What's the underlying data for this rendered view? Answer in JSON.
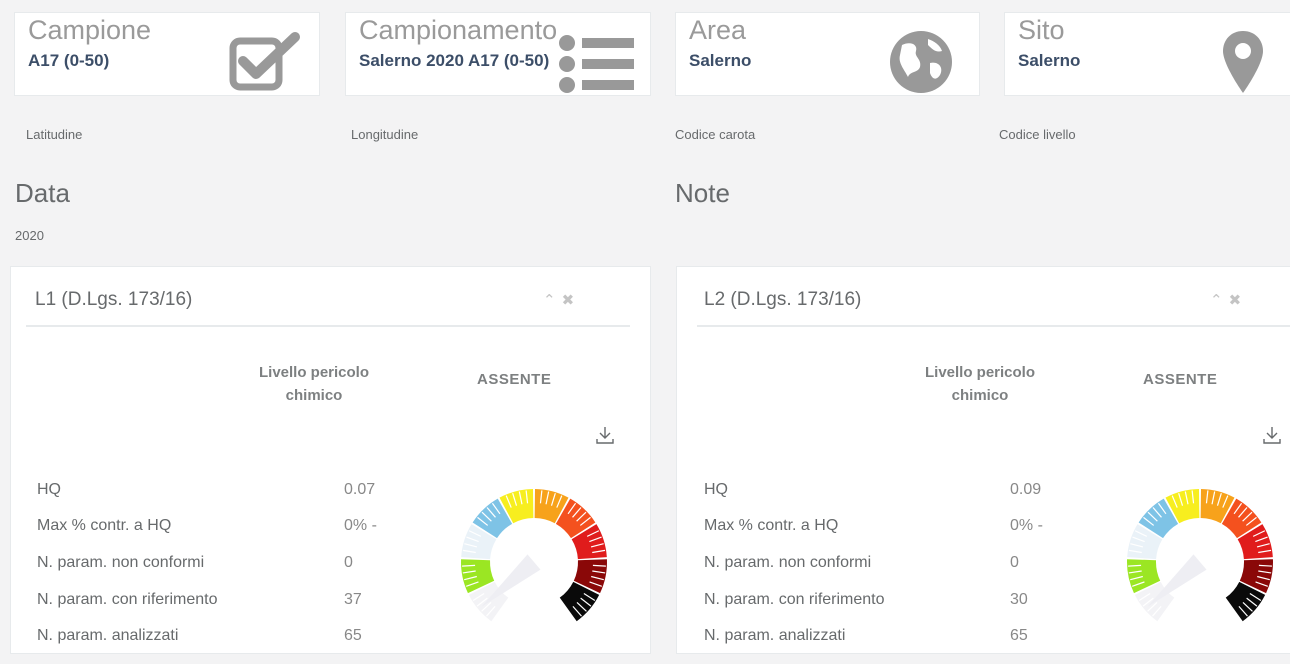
{
  "cards": [
    {
      "title": "Campione",
      "value": "A17 (0-50)",
      "icon": "checkbox-icon"
    },
    {
      "title": "Campionamento",
      "value": "Salerno 2020 A17 (0-50)",
      "icon": "list-icon"
    },
    {
      "title": "Area",
      "value": "Salerno",
      "icon": "globe-icon"
    },
    {
      "title": "Sito",
      "value": "Salerno",
      "icon": "map-marker-icon"
    }
  ],
  "meta_labels": {
    "latitude": "Latitudine",
    "longitude": "Longitudine",
    "core_code": "Codice carota",
    "level_code": "Codice livello"
  },
  "data_section": {
    "title": "Data",
    "value": "2020"
  },
  "note_section": {
    "title": "Note"
  },
  "panels": [
    {
      "title": "L1 (D.Lgs. 173/16)",
      "tools": "^ ×",
      "level_label_line1": "Livello pericolo",
      "level_label_line2": "chimico",
      "level_value": "ASSENTE",
      "stats": [
        {
          "label": "HQ",
          "value": "0.07"
        },
        {
          "label": "Max % contr. a HQ",
          "value": "0% -"
        },
        {
          "label": "N. param. non conformi",
          "value": "0"
        },
        {
          "label": "N. param. con riferimento",
          "value": "37"
        },
        {
          "label": "N. param. analizzati",
          "value": "65"
        }
      ]
    },
    {
      "title": "L2 (D.Lgs. 173/16)",
      "tools": "^ ×",
      "level_label_line1": "Livello pericolo",
      "level_label_line2": "chimico",
      "level_value": "ASSENTE",
      "stats": [
        {
          "label": "HQ",
          "value": "0.09"
        },
        {
          "label": "Max % contr. a HQ",
          "value": "0% -"
        },
        {
          "label": "N. param. non conformi",
          "value": "0"
        },
        {
          "label": "N. param. con riferimento",
          "value": "30"
        },
        {
          "label": "N. param. analizzati",
          "value": "65"
        }
      ]
    }
  ],
  "gauge_segments": [
    {
      "name": "absent",
      "color": "#f3f3f6"
    },
    {
      "name": "negligible",
      "color": "#9be623"
    },
    {
      "name": "low",
      "color": "#eaf2f8"
    },
    {
      "name": "moderate",
      "color": "#7ec3e6"
    },
    {
      "name": "medium",
      "color": "#f7ee1f"
    },
    {
      "name": "medium-high",
      "color": "#f7a21b"
    },
    {
      "name": "high",
      "color": "#f4511e"
    },
    {
      "name": "very-high",
      "color": "#e01c1c"
    },
    {
      "name": "severe",
      "color": "#8a0808"
    },
    {
      "name": "extreme",
      "color": "#0a0a0a"
    }
  ]
}
